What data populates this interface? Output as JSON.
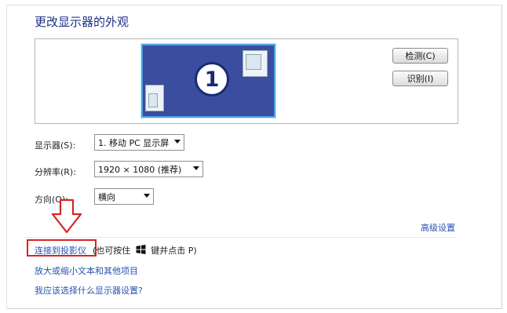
{
  "header": {
    "title": "更改显示器的外观"
  },
  "preview": {
    "monitor_number": "1",
    "detect_label": "检测(C)",
    "identify_label": "识别(I)"
  },
  "form": {
    "display": {
      "label": "显示器(S):",
      "value": "1. 移动 PC 显示屏"
    },
    "resolution": {
      "label": "分辨率(R):",
      "value": "1920 × 1080 (推荐)"
    },
    "orientation": {
      "label": "方向(O):",
      "value": "横向"
    }
  },
  "advanced_link": "高级设置",
  "links": {
    "projector": "连接到投影仪",
    "projector_note_1": "(也可按住",
    "projector_note_2": "键并点击 P)",
    "enlarge_text": "放大或缩小文本和其他项目",
    "which_settings": "我应该选择什么显示器设置?"
  },
  "colors": {
    "title": "#1e3287",
    "link": "#2753b0",
    "highlight": "#d62424",
    "monitor": "#3b4d9e"
  }
}
